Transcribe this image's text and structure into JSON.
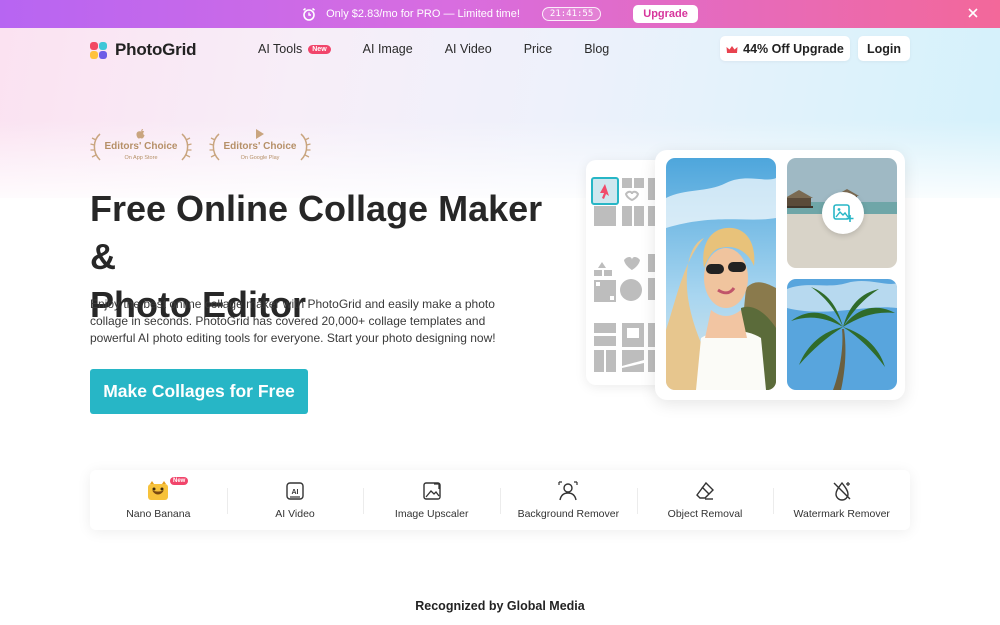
{
  "promo": {
    "text": "Only $2.83/mo for PRO — Limited time!",
    "timer": "21:41:55",
    "upgrade_label": "Upgrade",
    "gradient": [
      "#b765f2",
      "#f3689a"
    ]
  },
  "nav": {
    "logo_text": "PhotoGrid",
    "links": [
      {
        "label": "AI Tools",
        "badge": "New"
      },
      {
        "label": "AI Image"
      },
      {
        "label": "AI Video"
      },
      {
        "label": "Price"
      },
      {
        "label": "Blog"
      }
    ],
    "upgrade_label": "44% Off Upgrade",
    "login_label": "Login"
  },
  "awards": [
    {
      "title": "Editors' Choice",
      "subtitle": "On App Store",
      "icon": "apple-icon"
    },
    {
      "title": "Editors' Choice",
      "subtitle": "On Google Play",
      "icon": "google-play-icon"
    }
  ],
  "hero": {
    "headline_line1": "Free Online Collage Maker &",
    "headline_line2": "Photo Editor",
    "description": "Enjoy the best online collage maker with PhotoGrid and easily make a photo collage in seconds. PhotoGrid has covered 20,000+ collage templates and powerful AI photo editing tools for everyone. Start your photo designing now!",
    "cta_label": "Make Collages for Free",
    "accent_color": "#27b6c6"
  },
  "tools": [
    {
      "label": "Nano Banana",
      "icon": "banana-icon",
      "badge": "New"
    },
    {
      "label": "AI Video",
      "icon": "ai-video-icon"
    },
    {
      "label": "Image Upscaler",
      "icon": "image-upscale-icon"
    },
    {
      "label": "Background Remover",
      "icon": "person-cutout-icon"
    },
    {
      "label": "Object Removal",
      "icon": "eraser-icon"
    },
    {
      "label": "Watermark Remover",
      "icon": "watermark-remove-icon"
    }
  ],
  "recognized_heading": "Recognized by Global Media"
}
